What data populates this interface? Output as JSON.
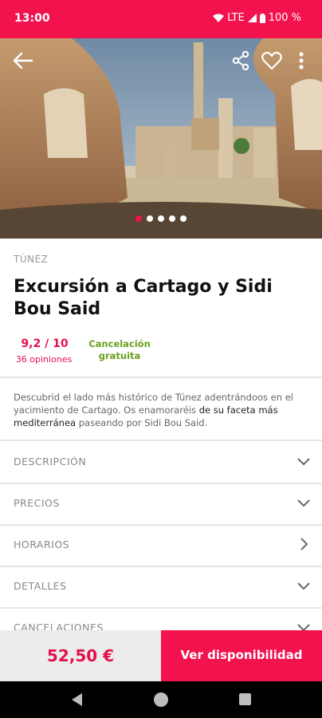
{
  "status": {
    "time": "13:00",
    "network": "LTE",
    "battery": "100 %"
  },
  "colors": {
    "brand": "#f2124e",
    "rating": "#e5104a",
    "cancel_green": "#6aa01e"
  },
  "hero": {
    "icons": [
      "back-arrow-icon",
      "share-icon",
      "heart-icon",
      "more-vert-icon"
    ],
    "carousel": {
      "count": 5,
      "active": 1
    }
  },
  "product": {
    "location": "TÚNEZ",
    "title": "Excursión a Cartago y Sidi Bou Said",
    "rating": "9,2 / 10",
    "reviews": "36 opiniones",
    "cancellation": [
      "Cancelación",
      "gratuita"
    ],
    "description_a": "Descubrid el lado más histórico de Túnez adentrándoos en el yacimiento de Cartago. Os enamoraréis ",
    "description_b": "de su faceta más mediterránea",
    "description_c": " paseando por Sidi Bou Said."
  },
  "sections": [
    {
      "label": "DESCRIPCIÓN",
      "icon": "chevron-down-icon"
    },
    {
      "label": "PRECIOS",
      "icon": "chevron-down-icon"
    },
    {
      "label": "HORARIOS",
      "icon": "chevron-right-icon"
    },
    {
      "label": "DETALLES",
      "icon": "chevron-down-icon"
    },
    {
      "label": "CANCELACIONES",
      "icon": "chevron-down-icon"
    }
  ],
  "footer": {
    "price": "52,50 €",
    "cta": "Ver disponibilidad"
  }
}
